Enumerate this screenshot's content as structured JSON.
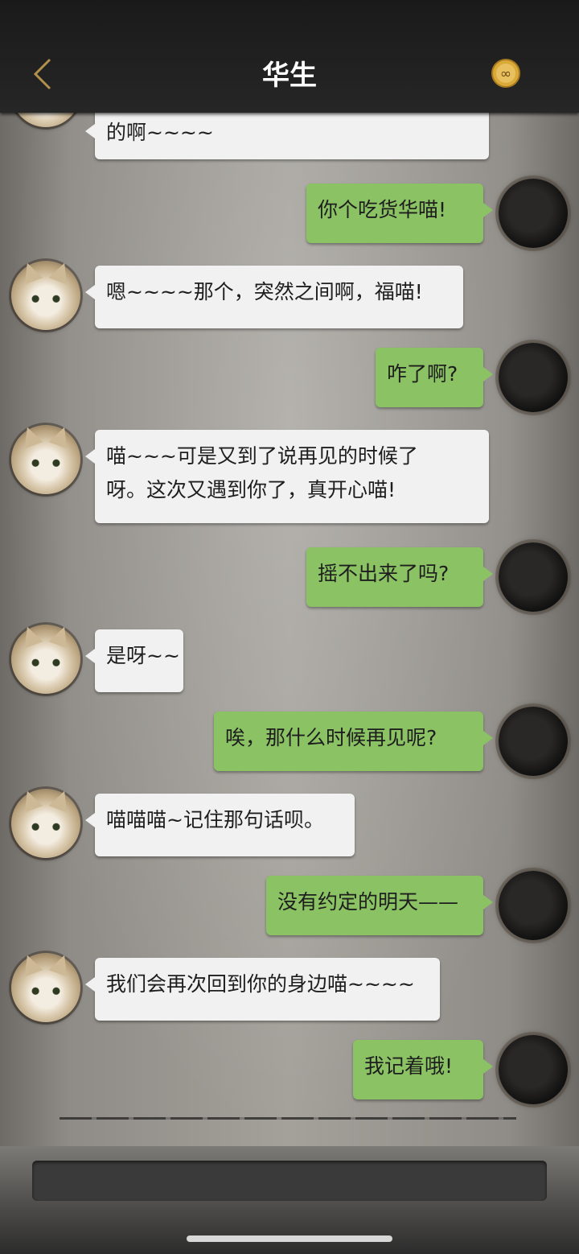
{
  "header": {
    "title": "华生",
    "back_icon": "chevron-left-icon",
    "badge_icon": "infinity-coin-icon"
  },
  "messages": [
    {
      "from": "other",
      "text": [
        "的啊~~~~"
      ]
    },
    {
      "from": "me",
      "text": [
        "你个吃货华喵!"
      ]
    },
    {
      "from": "other",
      "text": [
        "嗯~~~~那个，突然之间啊，福喵!"
      ]
    },
    {
      "from": "me",
      "text": [
        "咋了啊?"
      ]
    },
    {
      "from": "other",
      "text": [
        "喵~~~可是又到了说再见的时候了",
        "呀。这次又遇到你了，真开心喵!"
      ]
    },
    {
      "from": "me",
      "text": [
        "摇不出来了吗?"
      ]
    },
    {
      "from": "other",
      "text": [
        "是呀~~"
      ]
    },
    {
      "from": "me",
      "text": [
        "唉，那什么时候再见呢?"
      ]
    },
    {
      "from": "other",
      "text": [
        "喵喵喵~记住那句话呗。"
      ]
    },
    {
      "from": "me",
      "text": [
        "没有约定的明天——"
      ]
    },
    {
      "from": "other",
      "text": [
        "我们会再次回到你的身边喵~~~~"
      ]
    },
    {
      "from": "me",
      "text": [
        "我记着哦!"
      ]
    }
  ],
  "input": {
    "placeholder": ""
  },
  "colors": {
    "bubble_in": "#f1f1f1",
    "bubble_out": "#8ac264",
    "header_bg": "#1e1e1e"
  }
}
